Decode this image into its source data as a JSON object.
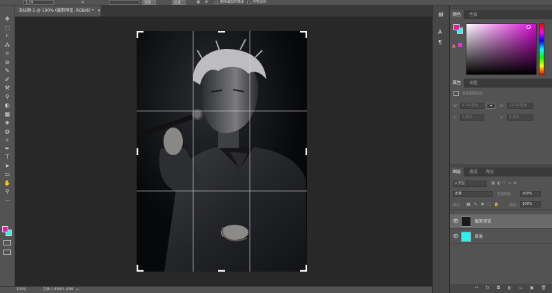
{
  "options_bar": {
    "width_value": "1.29",
    "btn_a": "清除",
    "btn_b": "拉直",
    "cb1": "删除裁剪的像素",
    "cb2": "内容识别"
  },
  "document_tab": {
    "title": "未标题-1 @ 100% (裁剪预览, RGB/8) *",
    "close": "×"
  },
  "tools": [
    "✥",
    "⬚",
    "ᵖ",
    "⁂",
    "⌗",
    "⊘",
    "✎",
    "✐",
    "⚒",
    "⚲",
    "◐",
    "▩",
    "◈",
    "◍",
    "⬨",
    "✒",
    "T",
    "➤",
    "▭",
    "✋",
    "⚲",
    "⋯"
  ],
  "colors": {
    "foreground": "#e41ba8",
    "background": "#2ef0f0",
    "picker_hue": "#d50ad3"
  },
  "status_bar": {
    "zoom": "100%",
    "doc_info": "文档:1.43M/1.43M"
  },
  "mini_column": {
    "icons": [
      "A",
      "¶"
    ]
  },
  "color_panel": {
    "tabs": [
      "颜色",
      "色板"
    ]
  },
  "properties_panel": {
    "tabs": [
      "属性",
      "调整"
    ],
    "header": "像素图层属性",
    "w_label": "W:",
    "w_value": "8.26 厘米",
    "link_icon": "⚭",
    "h_label": "H:",
    "h_value": "11.69 厘米",
    "x_label": "X:",
    "x_value": "0 厘米",
    "y_label": "Y:",
    "y_value": "0 厘米"
  },
  "layers_panel": {
    "tabs": [
      "图层",
      "通道",
      "路径"
    ],
    "filter_label": "ρ 类型",
    "blend_mode": "正常",
    "opacity_label": "不透明度:",
    "opacity_value": "100%",
    "lock_label": "锁定:",
    "fill_label": "填充:",
    "fill_value": "100%",
    "layers": [
      {
        "name": "裁剪预览",
        "selected": true
      },
      {
        "name": "背景",
        "selected": false
      }
    ],
    "bottom_icons": [
      "⚯",
      "fx",
      "◘",
      "◐",
      "▭",
      "▣",
      "🗑"
    ]
  }
}
